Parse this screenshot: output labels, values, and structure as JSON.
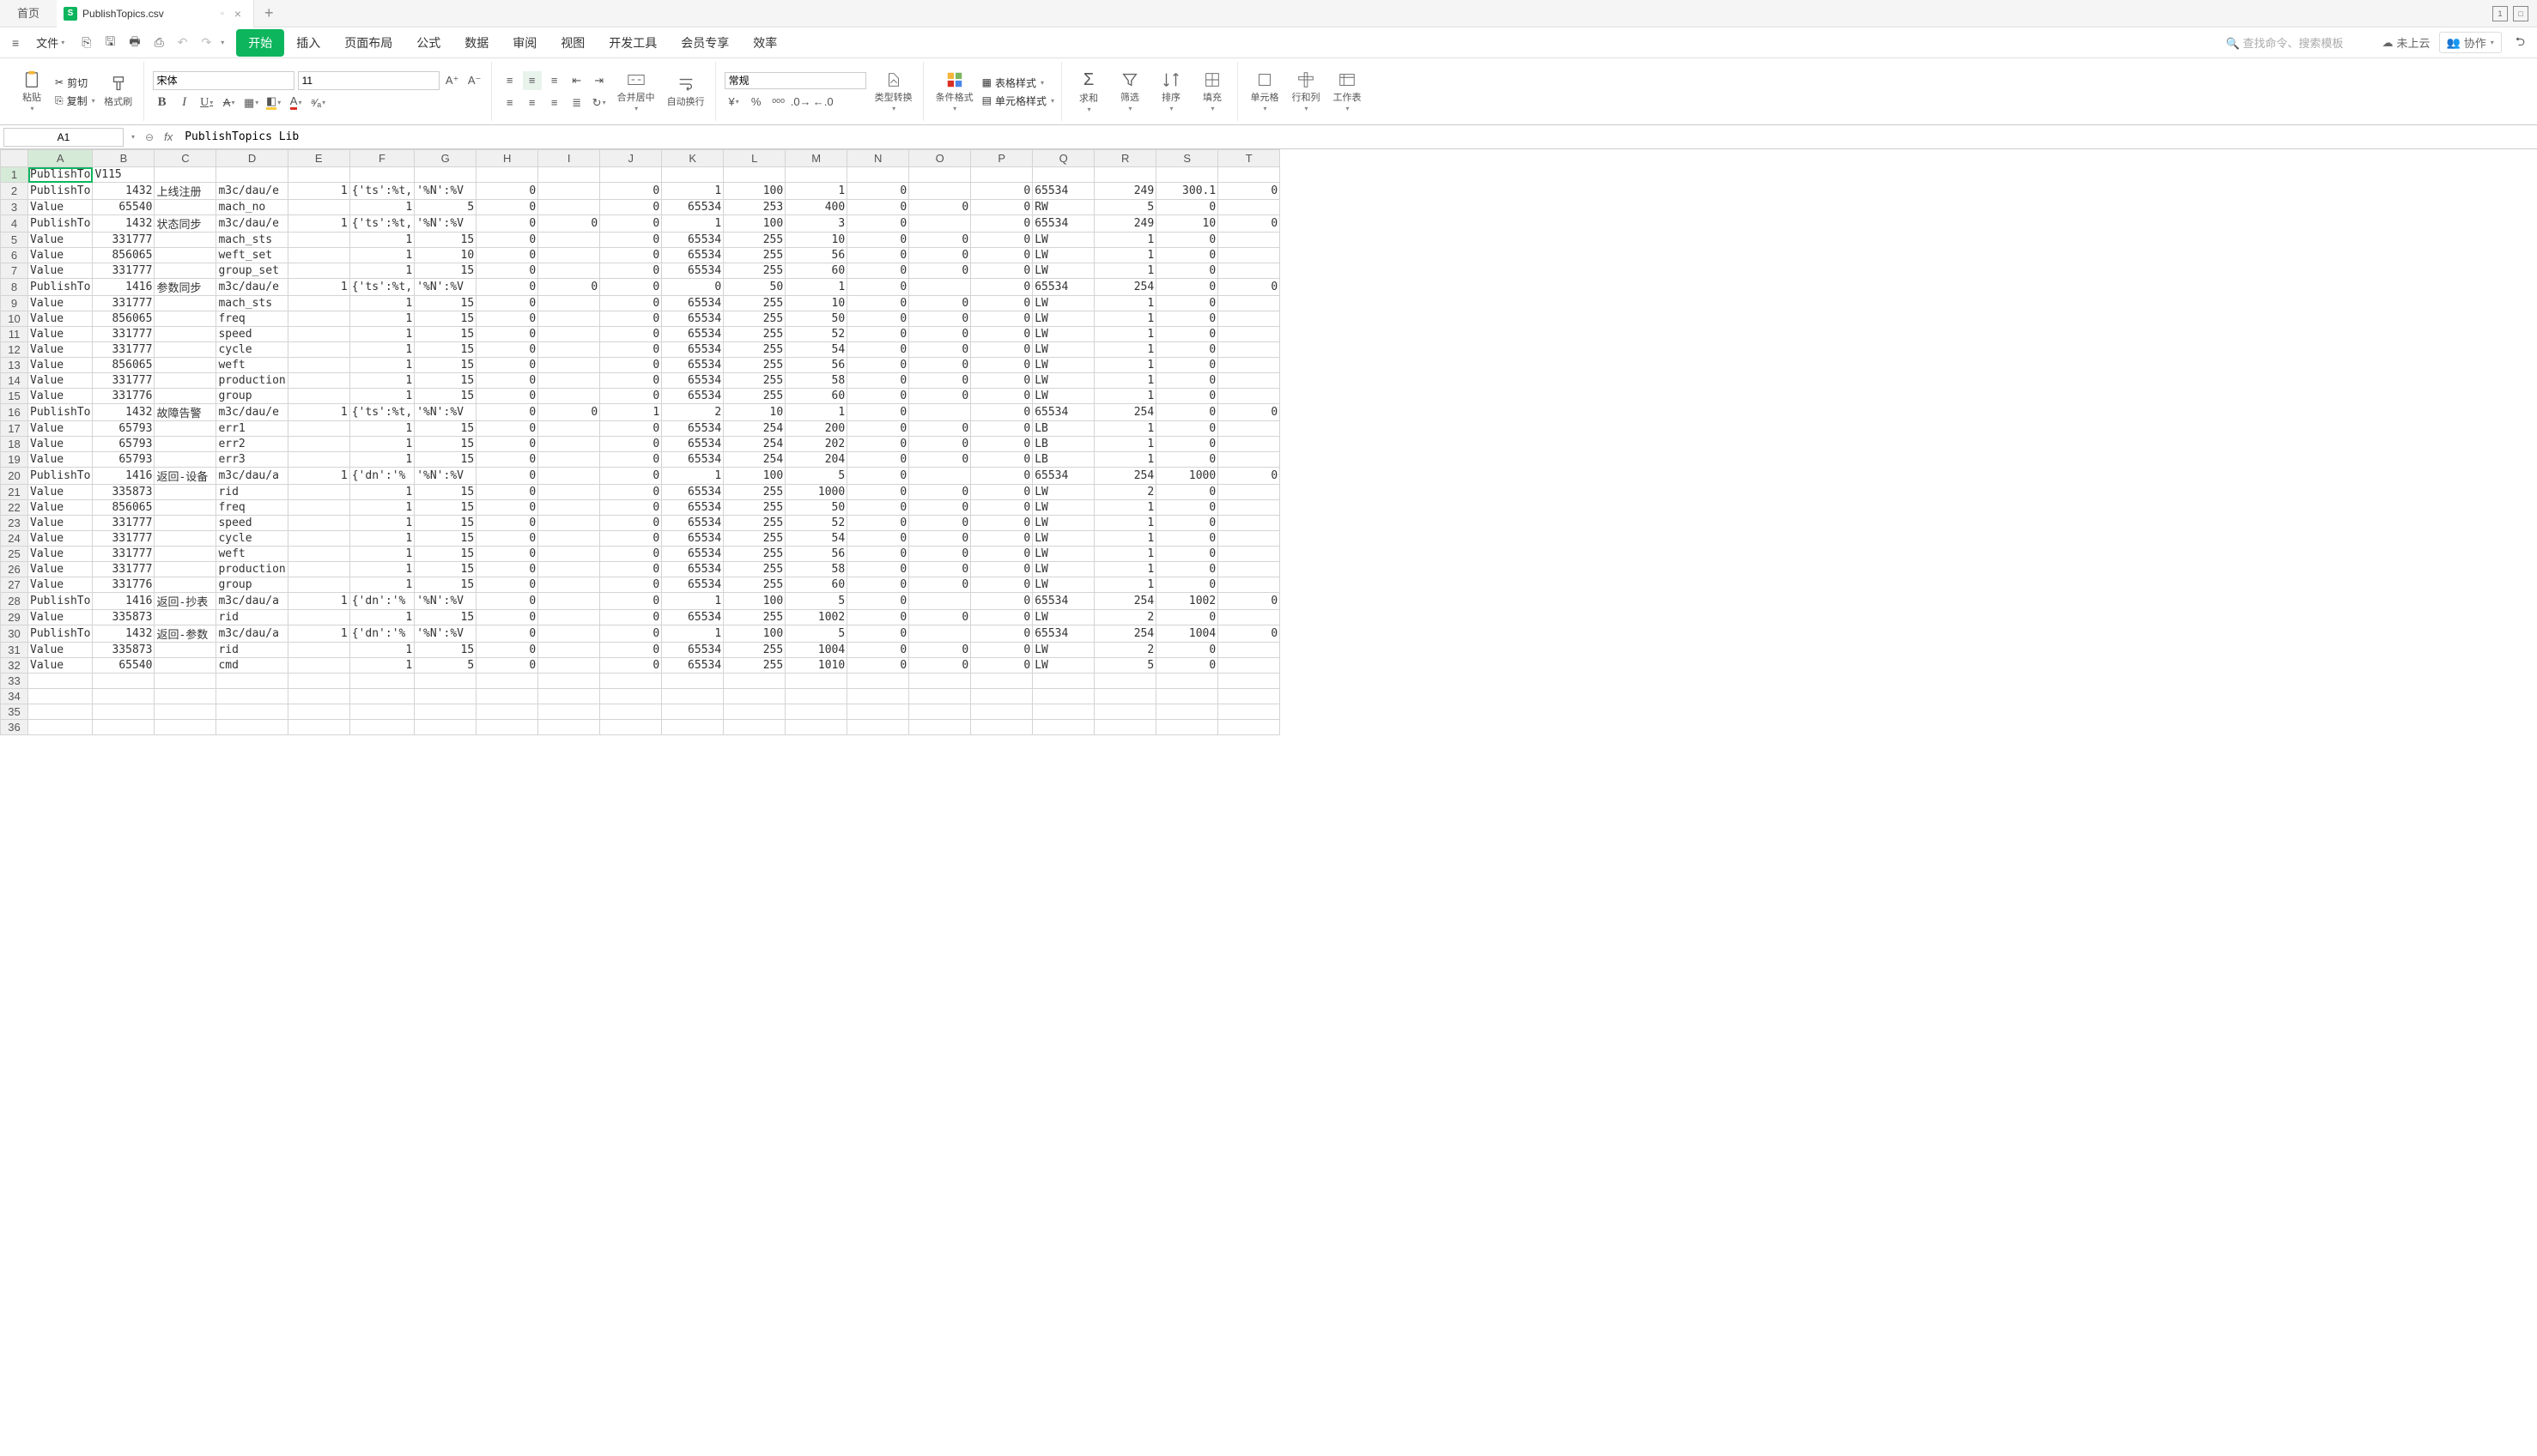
{
  "titlebar": {
    "home": "首页",
    "filename": "PublishTopics.csv",
    "win_btn": "1"
  },
  "menubar": {
    "file": "文件",
    "tabs": [
      "开始",
      "插入",
      "页面布局",
      "公式",
      "数据",
      "审阅",
      "视图",
      "开发工具",
      "会员专享",
      "效率"
    ],
    "active_idx": 0,
    "search_ph": "查找命令、搜索模板",
    "cloud": "未上云",
    "coop": "协作"
  },
  "ribbon": {
    "paste": "粘贴",
    "cut": "剪切",
    "copy": "复制",
    "brush": "格式刷",
    "font_name": "宋体",
    "font_size": "11",
    "merge": "合并居中",
    "wrap": "自动换行",
    "numfmt": "常规",
    "typeconv": "类型转换",
    "condfmt": "条件格式",
    "tablefmt": "表格样式",
    "cellfmt": "单元格样式",
    "sum": "求和",
    "filter": "筛选",
    "sort": "排序",
    "fill": "填充",
    "cells": "单元格",
    "rowcol": "行和列",
    "sheet": "工作表"
  },
  "namebox": {
    "ref": "A1",
    "formula": "PublishTopics Lib"
  },
  "columns": [
    "A",
    "B",
    "C",
    "D",
    "E",
    "F",
    "G",
    "H",
    "I",
    "J",
    "K",
    "L",
    "M",
    "N",
    "O",
    "P",
    "Q",
    "R",
    "S",
    "T"
  ],
  "rows": [
    {
      "n": 1,
      "c": [
        "PublishTo",
        "V115",
        "",
        "",
        "",
        "",
        "",
        "",
        "",
        "",
        "",
        "",
        "",
        "",
        "",
        "",
        "",
        "",
        "",
        ""
      ]
    },
    {
      "n": 2,
      "c": [
        "PublishTo",
        "1432",
        "上线注册",
        "m3c/dau/e",
        "1",
        "{'ts':%t,",
        "'%N':%V",
        "0",
        "",
        "0",
        "1",
        "100",
        "1",
        "0",
        "",
        "0",
        "65534",
        "249",
        "300.1",
        "0"
      ]
    },
    {
      "n": 3,
      "c": [
        "Value",
        "65540",
        "",
        "mach_no",
        "",
        "1",
        "5",
        "0",
        "",
        "0",
        "65534",
        "253",
        "400",
        "0",
        "0",
        "0",
        "RW",
        "5",
        "0",
        ""
      ]
    },
    {
      "n": 4,
      "c": [
        "PublishTo",
        "1432",
        "状态同步",
        "m3c/dau/e",
        "1",
        "{'ts':%t,",
        "'%N':%V",
        "0",
        "0",
        "0",
        "1",
        "100",
        "3",
        "0",
        "",
        "0",
        "65534",
        "249",
        "10",
        "0"
      ]
    },
    {
      "n": 5,
      "c": [
        "Value",
        "331777",
        "",
        "mach_sts",
        "",
        "1",
        "15",
        "0",
        "",
        "0",
        "65534",
        "255",
        "10",
        "0",
        "0",
        "0",
        "LW",
        "1",
        "0",
        ""
      ]
    },
    {
      "n": 6,
      "c": [
        "Value",
        "856065",
        "",
        "weft_set",
        "",
        "1",
        "10",
        "0",
        "",
        "0",
        "65534",
        "255",
        "56",
        "0",
        "0",
        "0",
        "LW",
        "1",
        "0",
        ""
      ]
    },
    {
      "n": 7,
      "c": [
        "Value",
        "331777",
        "",
        "group_set",
        "",
        "1",
        "15",
        "0",
        "",
        "0",
        "65534",
        "255",
        "60",
        "0",
        "0",
        "0",
        "LW",
        "1",
        "0",
        ""
      ]
    },
    {
      "n": 8,
      "c": [
        "PublishTo",
        "1416",
        "参数同步",
        "m3c/dau/e",
        "1",
        "{'ts':%t,",
        "'%N':%V",
        "0",
        "0",
        "0",
        "0",
        "50",
        "1",
        "0",
        "",
        "0",
        "65534",
        "254",
        "0",
        "0"
      ]
    },
    {
      "n": 9,
      "c": [
        "Value",
        "331777",
        "",
        "mach_sts",
        "",
        "1",
        "15",
        "0",
        "",
        "0",
        "65534",
        "255",
        "10",
        "0",
        "0",
        "0",
        "LW",
        "1",
        "0",
        ""
      ]
    },
    {
      "n": 10,
      "c": [
        "Value",
        "856065",
        "",
        "freq",
        "",
        "1",
        "15",
        "0",
        "",
        "0",
        "65534",
        "255",
        "50",
        "0",
        "0",
        "0",
        "LW",
        "1",
        "0",
        ""
      ]
    },
    {
      "n": 11,
      "c": [
        "Value",
        "331777",
        "",
        "speed",
        "",
        "1",
        "15",
        "0",
        "",
        "0",
        "65534",
        "255",
        "52",
        "0",
        "0",
        "0",
        "LW",
        "1",
        "0",
        ""
      ]
    },
    {
      "n": 12,
      "c": [
        "Value",
        "331777",
        "",
        "cycle",
        "",
        "1",
        "15",
        "0",
        "",
        "0",
        "65534",
        "255",
        "54",
        "0",
        "0",
        "0",
        "LW",
        "1",
        "0",
        ""
      ]
    },
    {
      "n": 13,
      "c": [
        "Value",
        "856065",
        "",
        "weft",
        "",
        "1",
        "15",
        "0",
        "",
        "0",
        "65534",
        "255",
        "56",
        "0",
        "0",
        "0",
        "LW",
        "1",
        "0",
        ""
      ]
    },
    {
      "n": 14,
      "c": [
        "Value",
        "331777",
        "",
        "production",
        "",
        "1",
        "15",
        "0",
        "",
        "0",
        "65534",
        "255",
        "58",
        "0",
        "0",
        "0",
        "LW",
        "1",
        "0",
        ""
      ]
    },
    {
      "n": 15,
      "c": [
        "Value",
        "331776",
        "",
        "group",
        "",
        "1",
        "15",
        "0",
        "",
        "0",
        "65534",
        "255",
        "60",
        "0",
        "0",
        "0",
        "LW",
        "1",
        "0",
        ""
      ]
    },
    {
      "n": 16,
      "c": [
        "PublishTo",
        "1432",
        "故障告警",
        "m3c/dau/e",
        "1",
        "{'ts':%t,",
        "'%N':%V",
        "0",
        "0",
        "1",
        "2",
        "10",
        "1",
        "0",
        "",
        "0",
        "65534",
        "254",
        "0",
        "0"
      ]
    },
    {
      "n": 17,
      "c": [
        "Value",
        "65793",
        "",
        "err1",
        "",
        "1",
        "15",
        "0",
        "",
        "0",
        "65534",
        "254",
        "200",
        "0",
        "0",
        "0",
        "LB",
        "1",
        "0",
        ""
      ]
    },
    {
      "n": 18,
      "c": [
        "Value",
        "65793",
        "",
        "err2",
        "",
        "1",
        "15",
        "0",
        "",
        "0",
        "65534",
        "254",
        "202",
        "0",
        "0",
        "0",
        "LB",
        "1",
        "0",
        ""
      ]
    },
    {
      "n": 19,
      "c": [
        "Value",
        "65793",
        "",
        "err3",
        "",
        "1",
        "15",
        "0",
        "",
        "0",
        "65534",
        "254",
        "204",
        "0",
        "0",
        "0",
        "LB",
        "1",
        "0",
        ""
      ]
    },
    {
      "n": 20,
      "c": [
        "PublishTo",
        "1416",
        "返回-设备",
        "m3c/dau/a",
        "1",
        "{'dn':'%",
        "'%N':%V",
        "0",
        "",
        "0",
        "1",
        "100",
        "5",
        "0",
        "",
        "0",
        "65534",
        "254",
        "1000",
        "0"
      ]
    },
    {
      "n": 21,
      "c": [
        "Value",
        "335873",
        "",
        "rid",
        "",
        "1",
        "15",
        "0",
        "",
        "0",
        "65534",
        "255",
        "1000",
        "0",
        "0",
        "0",
        "LW",
        "2",
        "0",
        ""
      ]
    },
    {
      "n": 22,
      "c": [
        "Value",
        "856065",
        "",
        "freq",
        "",
        "1",
        "15",
        "0",
        "",
        "0",
        "65534",
        "255",
        "50",
        "0",
        "0",
        "0",
        "LW",
        "1",
        "0",
        ""
      ]
    },
    {
      "n": 23,
      "c": [
        "Value",
        "331777",
        "",
        "speed",
        "",
        "1",
        "15",
        "0",
        "",
        "0",
        "65534",
        "255",
        "52",
        "0",
        "0",
        "0",
        "LW",
        "1",
        "0",
        ""
      ]
    },
    {
      "n": 24,
      "c": [
        "Value",
        "331777",
        "",
        "cycle",
        "",
        "1",
        "15",
        "0",
        "",
        "0",
        "65534",
        "255",
        "54",
        "0",
        "0",
        "0",
        "LW",
        "1",
        "0",
        ""
      ]
    },
    {
      "n": 25,
      "c": [
        "Value",
        "331777",
        "",
        "weft",
        "",
        "1",
        "15",
        "0",
        "",
        "0",
        "65534",
        "255",
        "56",
        "0",
        "0",
        "0",
        "LW",
        "1",
        "0",
        ""
      ]
    },
    {
      "n": 26,
      "c": [
        "Value",
        "331777",
        "",
        "production",
        "",
        "1",
        "15",
        "0",
        "",
        "0",
        "65534",
        "255",
        "58",
        "0",
        "0",
        "0",
        "LW",
        "1",
        "0",
        ""
      ]
    },
    {
      "n": 27,
      "c": [
        "Value",
        "331776",
        "",
        "group",
        "",
        "1",
        "15",
        "0",
        "",
        "0",
        "65534",
        "255",
        "60",
        "0",
        "0",
        "0",
        "LW",
        "1",
        "0",
        ""
      ]
    },
    {
      "n": 28,
      "c": [
        "PublishTo",
        "1416",
        "返回-抄表",
        "m3c/dau/a",
        "1",
        "{'dn':'%",
        "'%N':%V",
        "0",
        "",
        "0",
        "1",
        "100",
        "5",
        "0",
        "",
        "0",
        "65534",
        "254",
        "1002",
        "0"
      ]
    },
    {
      "n": 29,
      "c": [
        "Value",
        "335873",
        "",
        "rid",
        "",
        "1",
        "15",
        "0",
        "",
        "0",
        "65534",
        "255",
        "1002",
        "0",
        "0",
        "0",
        "LW",
        "2",
        "0",
        ""
      ]
    },
    {
      "n": 30,
      "c": [
        "PublishTo",
        "1432",
        "返回-参数",
        "m3c/dau/a",
        "1",
        "{'dn':'%",
        "'%N':%V",
        "0",
        "",
        "0",
        "1",
        "100",
        "5",
        "0",
        "",
        "0",
        "65534",
        "254",
        "1004",
        "0"
      ]
    },
    {
      "n": 31,
      "c": [
        "Value",
        "335873",
        "",
        "rid",
        "",
        "1",
        "15",
        "0",
        "",
        "0",
        "65534",
        "255",
        "1004",
        "0",
        "0",
        "0",
        "LW",
        "2",
        "0",
        ""
      ]
    },
    {
      "n": 32,
      "c": [
        "Value",
        "65540",
        "",
        "cmd",
        "",
        "1",
        "5",
        "0",
        "",
        "0",
        "65534",
        "255",
        "1010",
        "0",
        "0",
        "0",
        "LW",
        "5",
        "0",
        ""
      ]
    },
    {
      "n": 33,
      "c": [
        "",
        "",
        "",
        "",
        "",
        "",
        "",
        "",
        "",
        "",
        "",
        "",
        "",
        "",
        "",
        "",
        "",
        "",
        "",
        ""
      ]
    },
    {
      "n": 34,
      "c": [
        "",
        "",
        "",
        "",
        "",
        "",
        "",
        "",
        "",
        "",
        "",
        "",
        "",
        "",
        "",
        "",
        "",
        "",
        "",
        ""
      ]
    },
    {
      "n": 35,
      "c": [
        "",
        "",
        "",
        "",
        "",
        "",
        "",
        "",
        "",
        "",
        "",
        "",
        "",
        "",
        "",
        "",
        "",
        "",
        "",
        ""
      ]
    },
    {
      "n": 36,
      "c": [
        "",
        "",
        "",
        "",
        "",
        "",
        "",
        "",
        "",
        "",
        "",
        "",
        "",
        "",
        "",
        "",
        "",
        "",
        "",
        ""
      ]
    }
  ],
  "num_cols_idx": [
    1,
    4,
    5,
    6,
    7,
    8,
    9,
    10,
    11,
    12,
    13,
    14,
    15,
    17,
    18,
    19
  ],
  "selected": {
    "row": 1,
    "col": 0
  }
}
